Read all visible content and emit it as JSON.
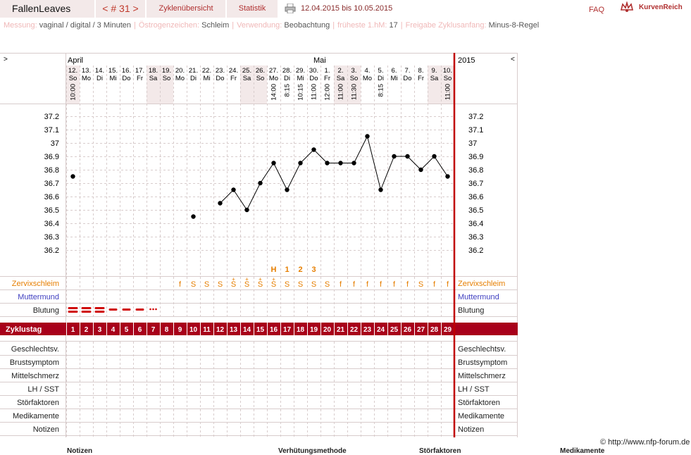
{
  "header": {
    "app_title": "FallenLeaves",
    "cycle_nav": "< # 31 >",
    "tab_overview": "Zyklenübersicht",
    "tab_stats": "Statistik",
    "date_range": "12.04.2015 bis 10.05.2015",
    "faq": "FAQ",
    "brand": "KurvenReich"
  },
  "info": [
    {
      "label": "Messung:",
      "value": "vaginal / digital / 3 Minuten"
    },
    {
      "label": "Östrogenzeichen:",
      "value": "Schleim"
    },
    {
      "label": "Verwendung:",
      "value": "Beobachtung"
    },
    {
      "label": "früheste 1.hM:",
      "value": "17"
    },
    {
      "label": "Freigabe Zyklusanfang:",
      "value": "Minus-8-Regel"
    }
  ],
  "nav": {
    "left": ">",
    "right": "<",
    "year": "2015"
  },
  "months": [
    {
      "label": "April",
      "day_index": 0
    },
    {
      "label": "Mai",
      "day_index": 19
    }
  ],
  "days": [
    {
      "d": "12.",
      "wd": "So",
      "time": "10:00",
      "shade": true
    },
    {
      "d": "13.",
      "wd": "Mo",
      "time": "",
      "shade": false
    },
    {
      "d": "14.",
      "wd": "Di",
      "time": "",
      "shade": false
    },
    {
      "d": "15.",
      "wd": "Mi",
      "time": "",
      "shade": false
    },
    {
      "d": "16.",
      "wd": "Do",
      "time": "",
      "shade": false
    },
    {
      "d": "17.",
      "wd": "Fr",
      "time": "",
      "shade": false
    },
    {
      "d": "18.",
      "wd": "Sa",
      "time": "",
      "shade": true
    },
    {
      "d": "19.",
      "wd": "So",
      "time": "",
      "shade": true
    },
    {
      "d": "20.",
      "wd": "Mo",
      "time": "",
      "shade": false
    },
    {
      "d": "21.",
      "wd": "Di",
      "time": "",
      "shade": false
    },
    {
      "d": "22.",
      "wd": "Mi",
      "time": "",
      "shade": false
    },
    {
      "d": "23.",
      "wd": "Do",
      "time": "",
      "shade": false
    },
    {
      "d": "24.",
      "wd": "Fr",
      "time": "",
      "shade": false
    },
    {
      "d": "25.",
      "wd": "Sa",
      "time": "",
      "shade": true
    },
    {
      "d": "26.",
      "wd": "So",
      "time": "",
      "shade": true
    },
    {
      "d": "27.",
      "wd": "Mo",
      "time": "14:00",
      "shade": false
    },
    {
      "d": "28.",
      "wd": "Di",
      "time": "8:15",
      "shade": false
    },
    {
      "d": "29.",
      "wd": "Mi",
      "time": "10:15",
      "shade": false
    },
    {
      "d": "30.",
      "wd": "Do",
      "time": "11:00",
      "shade": false
    },
    {
      "d": "1.",
      "wd": "Fr",
      "time": "12:00",
      "shade": false
    },
    {
      "d": "2.",
      "wd": "Sa",
      "time": "11:00",
      "shade": true
    },
    {
      "d": "3.",
      "wd": "So",
      "time": "11:30",
      "shade": true
    },
    {
      "d": "4.",
      "wd": "Mo",
      "time": "",
      "shade": false
    },
    {
      "d": "5.",
      "wd": "Di",
      "time": "8:15",
      "shade": false
    },
    {
      "d": "6.",
      "wd": "Mi",
      "time": "",
      "shade": false
    },
    {
      "d": "7.",
      "wd": "Do",
      "time": "",
      "shade": false
    },
    {
      "d": "8.",
      "wd": "Fr",
      "time": "",
      "shade": false
    },
    {
      "d": "9.",
      "wd": "Sa",
      "time": "",
      "shade": true
    },
    {
      "d": "10.",
      "wd": "So",
      "time": "11:00",
      "shade": true
    }
  ],
  "chart_data": {
    "type": "line",
    "x": [
      1,
      2,
      3,
      4,
      5,
      6,
      7,
      8,
      9,
      10,
      11,
      12,
      13,
      14,
      15,
      16,
      17,
      18,
      19,
      20,
      21,
      22,
      23,
      24,
      25,
      26,
      27,
      28,
      29
    ],
    "y": [
      36.75,
      null,
      null,
      null,
      null,
      null,
      null,
      null,
      null,
      36.45,
      null,
      36.55,
      36.65,
      36.5,
      36.7,
      36.85,
      36.65,
      36.85,
      36.95,
      36.85,
      36.85,
      36.85,
      37.05,
      36.65,
      36.9,
      36.9,
      36.8,
      36.9,
      36.75
    ],
    "ylim": [
      36.1,
      37.3
    ],
    "yticks": [
      "37.2",
      "37.1",
      "37",
      "36.9",
      "36.8",
      "36.7",
      "36.6",
      "36.5",
      "36.4",
      "36.3",
      "36.2"
    ],
    "ytick_values": [
      37.2,
      37.1,
      37.0,
      36.9,
      36.8,
      36.7,
      36.6,
      36.5,
      36.4,
      36.3,
      36.2
    ],
    "grid": true
  },
  "peak_markers": [
    {
      "day": 16,
      "label": "H"
    },
    {
      "day": 17,
      "label": "1"
    },
    {
      "day": 18,
      "label": "2"
    },
    {
      "day": 19,
      "label": "3"
    }
  ],
  "rows": {
    "zervixschleim": "Zervixschleim",
    "muttermund": "Muttermund",
    "blutung": "Blutung",
    "zyklustag": "Zyklustag",
    "geschlechtsv": "Geschlechtsv.",
    "brustsymptom": "Brustsymptom",
    "mittelschmerz": "Mittelschmerz",
    "lh": "LH / SST",
    "stoerfaktoren": "Störfaktoren",
    "medikamente": "Medikamente",
    "notizen": "Notizen"
  },
  "mucus": [
    "",
    "",
    "",
    "",
    "",
    "",
    "",
    "",
    "f",
    "S",
    "S",
    "S",
    "S+",
    "S+",
    "S+",
    "S+",
    "S",
    "S",
    "S",
    "S",
    "f",
    "f",
    "f",
    "f",
    "f",
    "f",
    "S",
    "f",
    "f"
  ],
  "bleeding": [
    "heavy",
    "heavy",
    "heavy",
    "medium",
    "medium",
    "medium",
    "light",
    "",
    "",
    "",
    "",
    "",
    "",
    "",
    "",
    "",
    "",
    "",
    "",
    "",
    "",
    "",
    "",
    "",
    "",
    "",
    "",
    "",
    ""
  ],
  "cycle_days": [
    "1",
    "2",
    "3",
    "4",
    "5",
    "6",
    "7",
    "8",
    "9",
    "10",
    "11",
    "12",
    "13",
    "14",
    "15",
    "16",
    "17",
    "18",
    "19",
    "20",
    "21",
    "22",
    "23",
    "24",
    "25",
    "26",
    "27",
    "28",
    "29"
  ],
  "footer": {
    "copyright": "© http://www.nfp-forum.de",
    "headings": [
      "Notizen",
      "Verhütungsmethode",
      "Störfaktoren",
      "Medikamente"
    ]
  },
  "colors": {
    "accent": "#a8001a",
    "mucus": "#e67e00",
    "muttermund": "#4040c0",
    "bleeding": "#d00000",
    "shade": "#f3e9e9",
    "grid": "#d8cccc"
  }
}
